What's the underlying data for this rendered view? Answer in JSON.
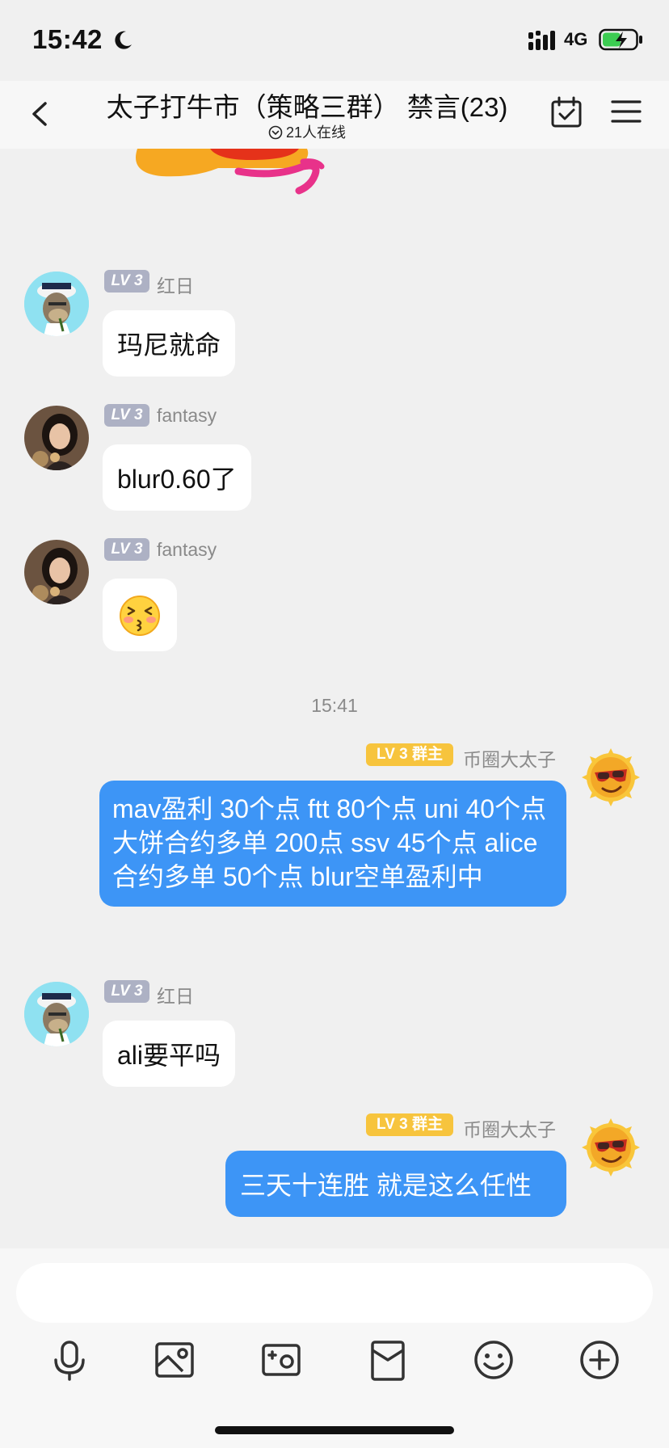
{
  "status_bar": {
    "time": "15:42",
    "network": "4G"
  },
  "header": {
    "title": "太子打牛市（策略三群） 禁言(23)",
    "online": "21人在线"
  },
  "messages": [
    {
      "sender": "红日",
      "level": "LV 3",
      "text": "玛尼就命"
    },
    {
      "sender": "fantasy",
      "level": "LV 3",
      "text": "blur0.60了"
    },
    {
      "sender": "fantasy",
      "level": "LV 3",
      "emoji": "😚"
    },
    {
      "timestamp": "15:41"
    },
    {
      "sender": "币圈大太子",
      "level": "LV 3 群主",
      "text": "mav盈利 30个点 ftt 80个点 uni 40个点 大饼合约多单 200点 ssv 45个点 alice合约多单 50个点  blur空单盈利中"
    },
    {
      "sender": "红日",
      "level": "LV 3",
      "text": "ali要平吗"
    },
    {
      "sender": "币圈大太子",
      "level": "LV 3 群主",
      "text": "三天十连胜 就是这么任性"
    }
  ],
  "input": {
    "placeholder": ""
  },
  "toolbar": [
    "mic-icon",
    "image-icon",
    "camera-icon",
    "red-packet-icon",
    "emoji-icon",
    "plus-icon"
  ],
  "colors": {
    "bubble_self": "#3d95f6",
    "badge_owner": "#f7c43d",
    "badge_level": "#adb1c4"
  }
}
